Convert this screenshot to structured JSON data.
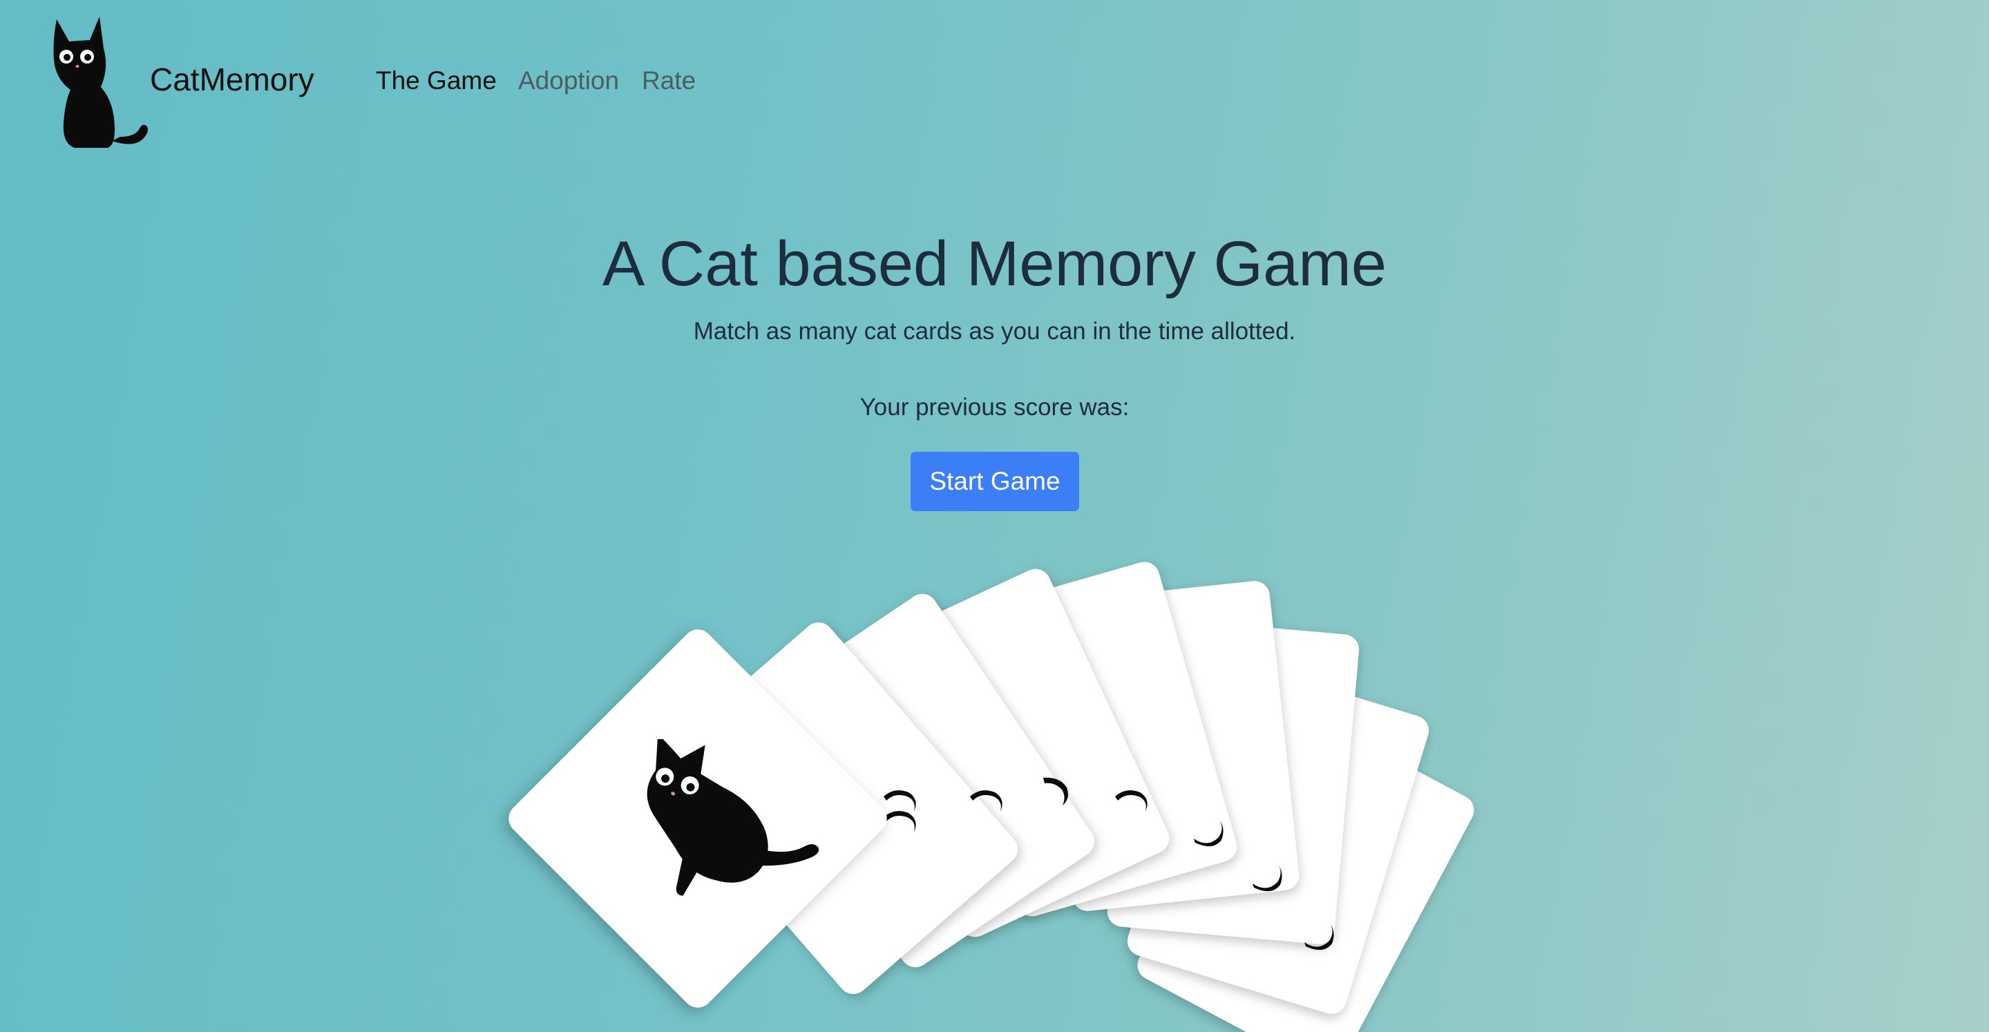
{
  "nav": {
    "brand": "CatMemory",
    "links": [
      {
        "label": "The Game",
        "active": true
      },
      {
        "label": "Adoption",
        "active": false
      },
      {
        "label": "Rate",
        "active": false
      }
    ]
  },
  "hero": {
    "title": "A Cat based Memory Game",
    "subtitle": "Match as many cat cards as you can in the time allotted.",
    "score_label": "Your previous score was:",
    "start_button": "Start Game"
  },
  "cards": {
    "count": 9,
    "face_up_image": "black-cat",
    "face_down_image": "cat-tail"
  },
  "colors": {
    "background_start": "#63bcc6",
    "background_end": "#a7cfcb",
    "button": "#3b7ef6",
    "heading": "#1d2d3e"
  }
}
